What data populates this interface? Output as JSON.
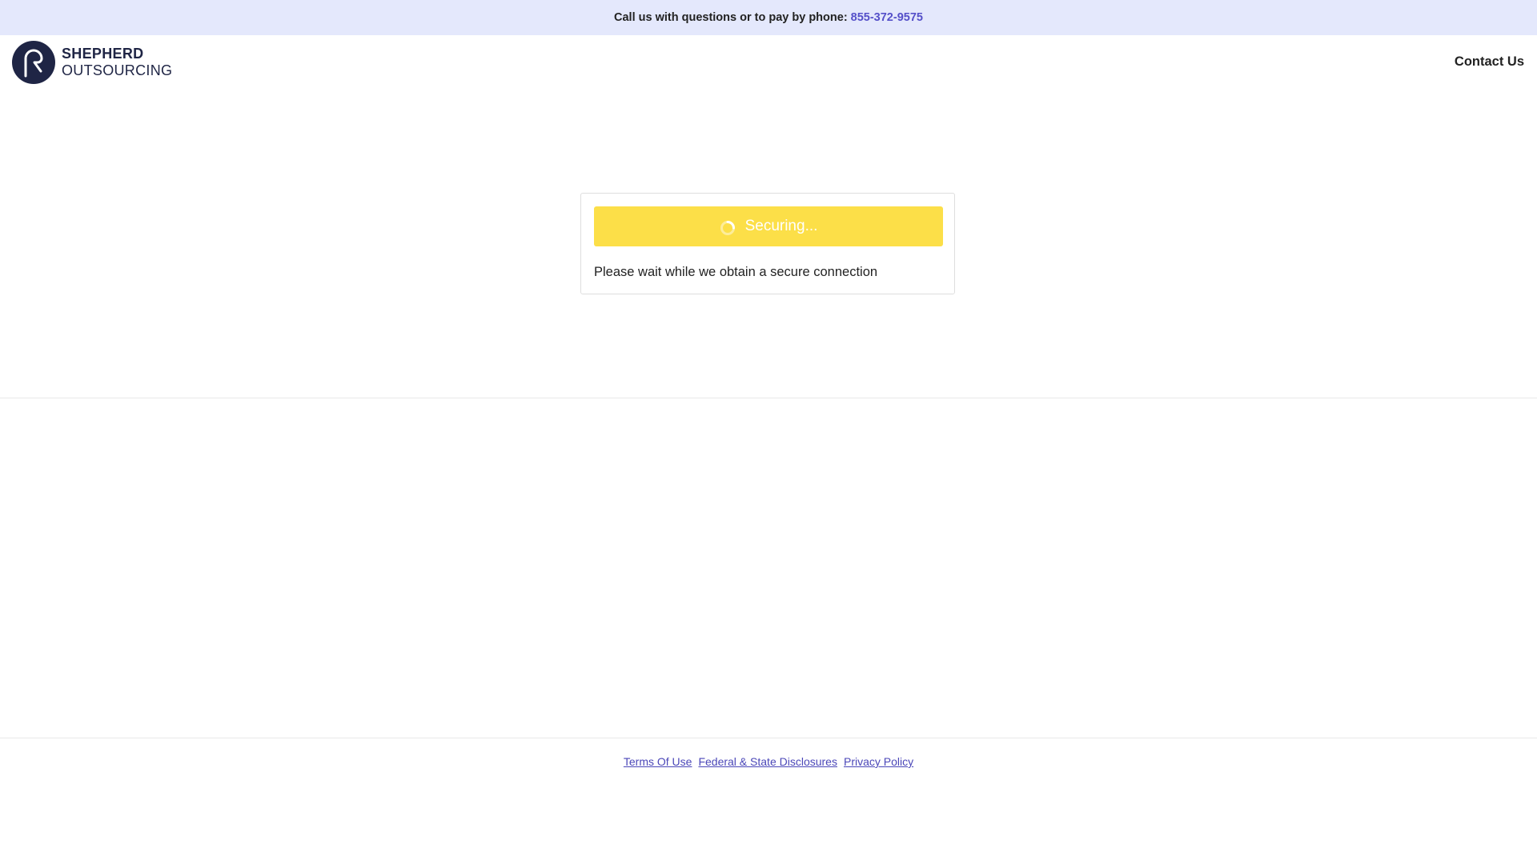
{
  "topbar": {
    "message": "Call us with questions or to pay by phone:",
    "phone": "855-372-9575"
  },
  "header": {
    "logo": {
      "line1": "SHEPHERD",
      "line2": "OUTSOURCING",
      "icon": "shepherd-crook-logo-icon"
    },
    "contact_label": "Contact Us"
  },
  "main": {
    "status_button_label": "Securing...",
    "spinner_icon": "loading-spinner-icon",
    "wait_message": "Please wait while we obtain a secure connection"
  },
  "footer": {
    "links": [
      "Terms Of Use",
      "Federal & State Disclosures",
      "Privacy Policy"
    ]
  },
  "colors": {
    "topbar_bg": "#e4e8fc",
    "accent_link": "#5550c9",
    "button_yellow": "#fcdf48",
    "logo_navy": "#1f2545"
  }
}
